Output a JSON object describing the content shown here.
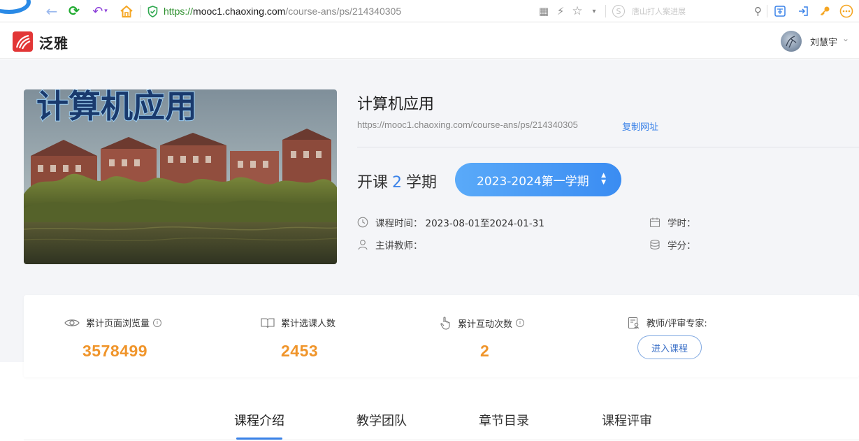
{
  "browser": {
    "url_scheme": "https://",
    "url_host": "mooc1.chaoxing.com",
    "url_path": "/course-ans/ps/214340305",
    "search_placeholder": "唐山打人案进展",
    "brand_color": "#2a8ae6"
  },
  "header": {
    "brand_name": "泛雅",
    "user_name": "刘慧宇",
    "brand_color": "#e23636"
  },
  "course": {
    "cover_text": "计算机应用",
    "title": "计算机应用",
    "url": "https://mooc1.chaoxing.com/course-ans/ps/214340305",
    "copy_label": "复制网址",
    "terms_prefix": "开课",
    "terms_count": "2",
    "terms_suffix": "学期",
    "term_selected": "2023-2024第一学期",
    "meta": {
      "time_label": "课程时间：",
      "time_value": "2023-08-01至2024-01-31",
      "teacher_label": "主讲教师：",
      "hours_label": "学时：",
      "credit_label": "学分："
    },
    "accent_color": "#3a82e8"
  },
  "stats": {
    "views_label": "累计页面浏览量",
    "views_value": "3578499",
    "enroll_label": "累计选课人数",
    "enroll_value": "2453",
    "interact_label": "累计互动次数",
    "interact_value": "2",
    "expert_label": "教师/评审专家:",
    "enter_label": "进入课程",
    "value_color": "#f0952b"
  },
  "tabs": [
    {
      "label": "课程介绍",
      "active": true
    },
    {
      "label": "教学团队",
      "active": false
    },
    {
      "label": "章节目录",
      "active": false
    },
    {
      "label": "课程评审",
      "active": false
    }
  ]
}
